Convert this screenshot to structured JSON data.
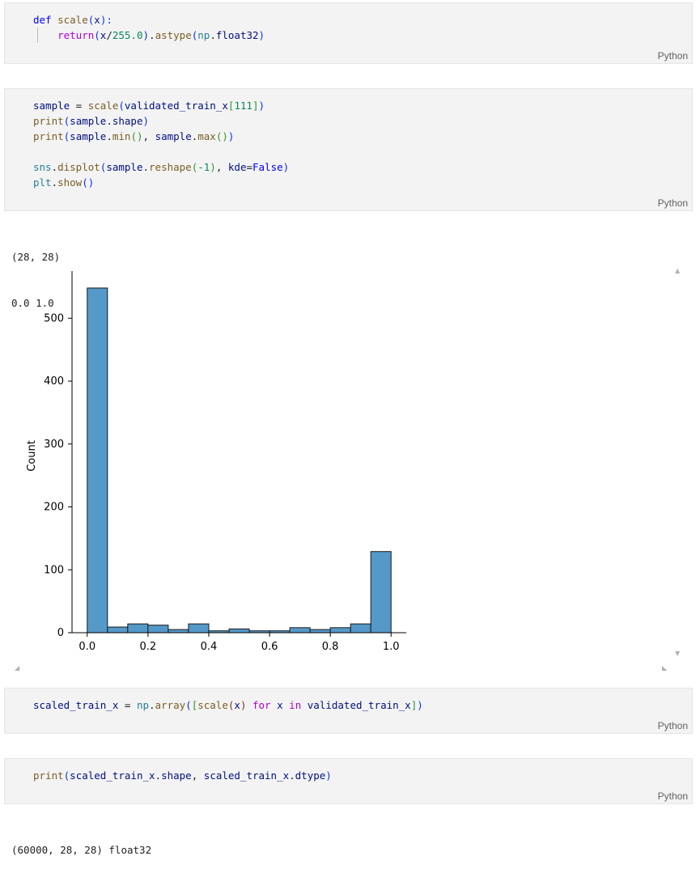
{
  "cells": [
    {
      "language": "Python",
      "lines": [
        [
          [
            "def",
            "kw"
          ],
          [
            " ",
            ""
          ],
          [
            "scale",
            "fn"
          ],
          [
            "(",
            "br1"
          ],
          [
            "x",
            "var"
          ],
          [
            "):",
            "br1"
          ]
        ],
        [
          [
            "    ",
            ""
          ],
          [
            "return",
            "kw2"
          ],
          [
            "(",
            "br1"
          ],
          [
            "x",
            "var"
          ],
          [
            "/",
            ""
          ],
          [
            "255.0",
            "num"
          ],
          [
            ")",
            "br1"
          ],
          [
            ".",
            ""
          ],
          [
            "astype",
            "fn"
          ],
          [
            "(",
            "br1"
          ],
          [
            "np",
            "mod"
          ],
          [
            ".",
            ""
          ],
          [
            "float32",
            "var"
          ],
          [
            ")",
            "br1"
          ]
        ]
      ]
    },
    {
      "language": "Python",
      "lines": [
        [
          [
            "sample",
            "var"
          ],
          [
            " = ",
            ""
          ],
          [
            "scale",
            "fn"
          ],
          [
            "(",
            "br1"
          ],
          [
            "validated_train_x",
            "var"
          ],
          [
            "[",
            "br2"
          ],
          [
            "111",
            "num"
          ],
          [
            "]",
            "br2"
          ],
          [
            ")",
            "br1"
          ]
        ],
        [
          [
            "print",
            "fn"
          ],
          [
            "(",
            "br1"
          ],
          [
            "sample",
            "var"
          ],
          [
            ".",
            ""
          ],
          [
            "shape",
            "var"
          ],
          [
            ")",
            "br1"
          ]
        ],
        [
          [
            "print",
            "fn"
          ],
          [
            "(",
            "br1"
          ],
          [
            "sample",
            "var"
          ],
          [
            ".",
            ""
          ],
          [
            "min",
            "fn"
          ],
          [
            "()",
            "br2"
          ],
          [
            ", ",
            ""
          ],
          [
            "sample",
            "var"
          ],
          [
            ".",
            ""
          ],
          [
            "max",
            "fn"
          ],
          [
            "()",
            "br2"
          ],
          [
            ")",
            "br1"
          ]
        ],
        [],
        [
          [
            "sns",
            "mod"
          ],
          [
            ".",
            ""
          ],
          [
            "displot",
            "fn"
          ],
          [
            "(",
            "br1"
          ],
          [
            "sample",
            "var"
          ],
          [
            ".",
            ""
          ],
          [
            "reshape",
            "fn"
          ],
          [
            "(",
            "br2"
          ],
          [
            "-1",
            "num"
          ],
          [
            ")",
            "br2"
          ],
          [
            ", ",
            ""
          ],
          [
            "kde",
            "var"
          ],
          [
            "=",
            ""
          ],
          [
            "False",
            "kw"
          ],
          [
            ")",
            "br1"
          ]
        ],
        [
          [
            "plt",
            "mod"
          ],
          [
            ".",
            ""
          ],
          [
            "show",
            "fn"
          ],
          [
            "()",
            "br1"
          ]
        ]
      ],
      "output": [
        "(28, 28)",
        "0.0 1.0"
      ]
    },
    {
      "language": "Python",
      "lines": [
        [
          [
            "scaled_train_x",
            "var"
          ],
          [
            " = ",
            ""
          ],
          [
            "np",
            "mod"
          ],
          [
            ".",
            ""
          ],
          [
            "array",
            "fn"
          ],
          [
            "(",
            "br1"
          ],
          [
            "[",
            "br2"
          ],
          [
            "scale",
            "fn"
          ],
          [
            "(",
            "br3"
          ],
          [
            "x",
            "var"
          ],
          [
            ")",
            "br3"
          ],
          [
            " ",
            ""
          ],
          [
            "for",
            "kw2"
          ],
          [
            " ",
            ""
          ],
          [
            "x",
            "var"
          ],
          [
            " ",
            ""
          ],
          [
            "in",
            "kw2"
          ],
          [
            " ",
            ""
          ],
          [
            "validated_train_x",
            "var"
          ],
          [
            "]",
            "br2"
          ],
          [
            ")",
            "br1"
          ]
        ]
      ]
    },
    {
      "language": "Python",
      "lines": [
        [
          [
            "print",
            "fn"
          ],
          [
            "(",
            "br1"
          ],
          [
            "scaled_train_x",
            "var"
          ],
          [
            ".",
            ""
          ],
          [
            "shape",
            "var"
          ],
          [
            ", ",
            ""
          ],
          [
            "scaled_train_x",
            "var"
          ],
          [
            ".",
            ""
          ],
          [
            "dtype",
            "var"
          ],
          [
            ")",
            "br1"
          ]
        ]
      ],
      "output": [
        "(60000, 28, 28) float32"
      ]
    }
  ],
  "chart_data": {
    "type": "bar",
    "ylabel": "Count",
    "xlabel": "",
    "bar_color": "#5499c7",
    "bin_edges": [
      0.0,
      0.0667,
      0.1333,
      0.2,
      0.2667,
      0.3333,
      0.4,
      0.4667,
      0.5333,
      0.6,
      0.6667,
      0.7333,
      0.8,
      0.8667,
      0.9333,
      1.0
    ],
    "values": [
      548,
      9,
      14,
      12,
      5,
      14,
      3,
      6,
      3,
      3,
      8,
      5,
      8,
      14,
      129
    ],
    "xlim": [
      -0.05,
      1.05
    ],
    "ylim": [
      0,
      575
    ],
    "xticks": [
      "0.0",
      "0.2",
      "0.4",
      "0.6",
      "0.8",
      "1.0"
    ],
    "xtick_values": [
      0.0,
      0.2,
      0.4,
      0.6,
      0.8,
      1.0
    ],
    "yticks": [
      "0",
      "100",
      "200",
      "300",
      "400",
      "500"
    ],
    "ytick_values": [
      0,
      100,
      200,
      300,
      400,
      500
    ]
  }
}
